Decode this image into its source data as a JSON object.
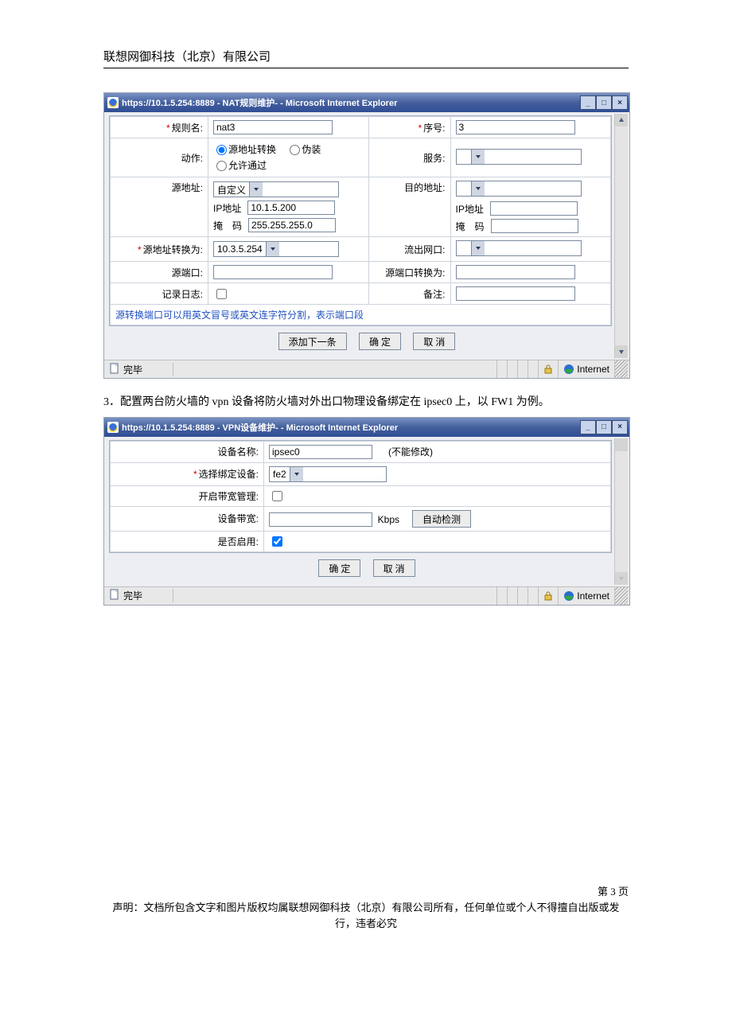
{
  "doc": {
    "company": "联想网御科技（北京）有限公司",
    "section3": "3．配置两台防火墙的 vpn 设备将防火墙对外出口物理设备绑定在 ipsec0 上，以 FW1 为例。",
    "page_num": "第 3 页",
    "disclaimer": "声明：文档所包含文字和图片版权均属联想网御科技（北京）有限公司所有，任何单位或个人不得擅自出版或发行，违者必究"
  },
  "win1": {
    "title": "https://10.1.5.254:8889 - NAT规则维护- - Microsoft Internet Explorer",
    "labels": {
      "rule_name": "规则名:",
      "seq": "序号:",
      "action": "动作:",
      "service": "服务:",
      "src_addr": "源地址:",
      "dst_addr": "目的地址:",
      "ip_addr": "IP地址",
      "mask": "掩　码",
      "snat_as": "源地址转换为:",
      "out_if": "流出网口:",
      "src_port": "源端口:",
      "src_port_xlate": "源端口转换为:",
      "log": "记录日志:",
      "remark": "备注:"
    },
    "radio": {
      "snat": "源地址转换",
      "masq": "伪装",
      "pass": "允许通过"
    },
    "values": {
      "rule_name": "nat3",
      "seq": "3",
      "src_combo": "自定义",
      "src_ip": "10.1.5.200",
      "src_mask": "255.255.255.0",
      "snat_combo": "10.3.5.254",
      "dst_combo": "",
      "service_combo": "",
      "out_if_combo": "",
      "dst_ip": "",
      "dst_mask": "",
      "src_port": "",
      "src_port_xlate": "",
      "remark": ""
    },
    "hint": "源转换端口可以用英文冒号或英文连字符分割，表示端口段",
    "buttons": {
      "add_next": "添加下一条",
      "ok": "确 定",
      "cancel": "取 消"
    },
    "status": {
      "done": "完毕",
      "zone": "Internet"
    }
  },
  "win2": {
    "title": "https://10.1.5.254:8889 - VPN设备维护- - Microsoft Internet Explorer",
    "labels": {
      "dev_name": "设备名称:",
      "bind_dev": "选择绑定设备:",
      "bw_mgmt": "开启带宽管理:",
      "bw": "设备带宽:",
      "enable": "是否启用:"
    },
    "values": {
      "dev_name": "ipsec0",
      "dev_name_note": "(不能修改)",
      "bind_combo": "fe2",
      "bw": "",
      "bw_unit": "Kbps"
    },
    "buttons": {
      "auto_detect": "自动检测",
      "ok": "确 定",
      "cancel": "取 消"
    },
    "status": {
      "done": "完毕",
      "zone": "Internet"
    }
  }
}
